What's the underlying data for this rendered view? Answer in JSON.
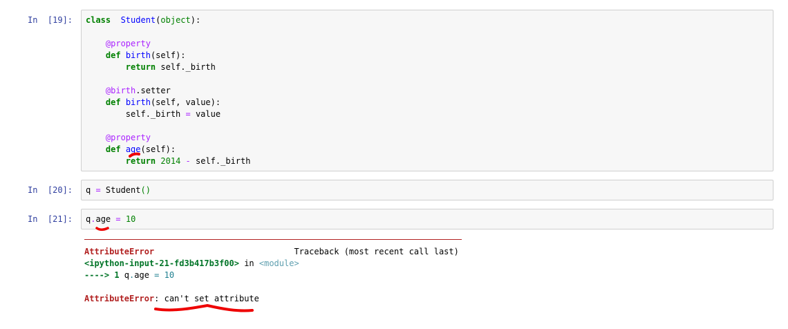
{
  "cells": [
    {
      "prompt": "In  [19]:",
      "lines": [
        [
          [
            "kw",
            "class"
          ],
          [
            "",
            "  "
          ],
          [
            "nm",
            "Student"
          ],
          [
            "",
            "("
          ],
          [
            "bi",
            "object"
          ],
          [
            "",
            "):"
          ]
        ],
        [],
        [
          [
            "",
            "    "
          ],
          [
            "dec",
            "@property"
          ]
        ],
        [
          [
            "",
            "    "
          ],
          [
            "kw",
            "def"
          ],
          [
            "",
            " "
          ],
          [
            "nm",
            "birth"
          ],
          [
            "",
            "(self):"
          ]
        ],
        [
          [
            "",
            "        "
          ],
          [
            "kw",
            "return"
          ],
          [
            "",
            " self._birth"
          ]
        ],
        [],
        [
          [
            "",
            "    "
          ],
          [
            "dec",
            "@birth"
          ],
          [
            "",
            ".setter"
          ]
        ],
        [
          [
            "",
            "    "
          ],
          [
            "kw",
            "def"
          ],
          [
            "",
            " "
          ],
          [
            "nm",
            "birth"
          ],
          [
            "",
            "(self, value):"
          ]
        ],
        [
          [
            "",
            "        self._birth "
          ],
          [
            "op",
            "="
          ],
          [
            "",
            " value"
          ]
        ],
        [],
        [
          [
            "",
            "    "
          ],
          [
            "dec",
            "@property"
          ]
        ],
        [
          [
            "",
            "    "
          ],
          [
            "kw",
            "def"
          ],
          [
            "",
            " "
          ],
          [
            "nm",
            "age"
          ],
          [
            "",
            "(self):"
          ]
        ],
        [
          [
            "",
            "        "
          ],
          [
            "kw",
            "return"
          ],
          [
            "",
            " "
          ],
          [
            "num",
            "2014"
          ],
          [
            "",
            " "
          ],
          [
            "op",
            "-"
          ],
          [
            "",
            " self._birth"
          ]
        ]
      ]
    },
    {
      "prompt": "In  [20]:",
      "lines": [
        [
          [
            "",
            "q "
          ],
          [
            "op",
            "="
          ],
          [
            "",
            " Student"
          ],
          [
            "bi",
            "()"
          ]
        ]
      ]
    },
    {
      "prompt": "In  [21]:",
      "lines": [
        [
          [
            "",
            "q"
          ],
          [
            "op",
            "."
          ],
          [
            "",
            "age "
          ],
          [
            "op",
            "="
          ],
          [
            "",
            " "
          ],
          [
            "num",
            "10"
          ]
        ]
      ]
    }
  ],
  "traceback": [
    [
      [
        "err",
        "AttributeError"
      ],
      [
        "",
        "                            Traceback (most recent call last)"
      ]
    ],
    [
      [
        "grn",
        "<ipython-input-21-fd3b417b3f00>"
      ],
      [
        "",
        " in "
      ],
      [
        "mod",
        "<module>"
      ]
    ],
    [
      [
        "grn",
        "----> 1 "
      ],
      [
        "",
        "q"
      ],
      [
        "cyan",
        "."
      ],
      [
        "",
        "age "
      ],
      [
        "cyan",
        "="
      ],
      [
        "",
        " "
      ],
      [
        "cyan",
        "10"
      ]
    ],
    [],
    [
      [
        "err",
        "AttributeError"
      ],
      [
        "",
        ": can't set attribute"
      ]
    ]
  ],
  "annotation_color": "#ee0000"
}
